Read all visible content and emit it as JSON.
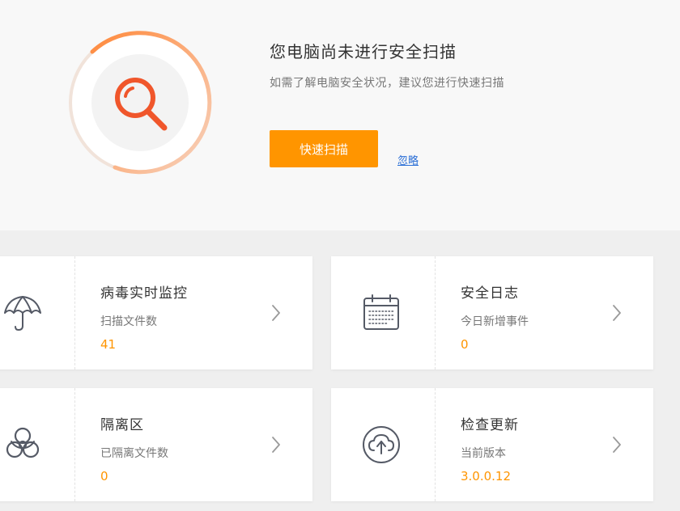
{
  "hero": {
    "title": "您电脑尚未进行安全扫描",
    "subtitle": "如需了解电脑安全状况，建议您进行快速扫描",
    "scan_button": "快速扫描",
    "ignore_link": "忽略",
    "icon": "search-icon",
    "accent_color": "#ff9500"
  },
  "cards": [
    {
      "title": "病毒实时监控",
      "label": "扫描文件数",
      "value": "41",
      "icon": "umbrella-icon"
    },
    {
      "title": "安全日志",
      "label": "今日新增事件",
      "value": "0",
      "icon": "calendar-icon"
    },
    {
      "title": "隔离区",
      "label": "已隔离文件数",
      "value": "0",
      "icon": "biohazard-icon"
    },
    {
      "title": "检查更新",
      "label": "当前版本",
      "value": "3.0.0.12",
      "icon": "upload-cloud-icon"
    }
  ]
}
